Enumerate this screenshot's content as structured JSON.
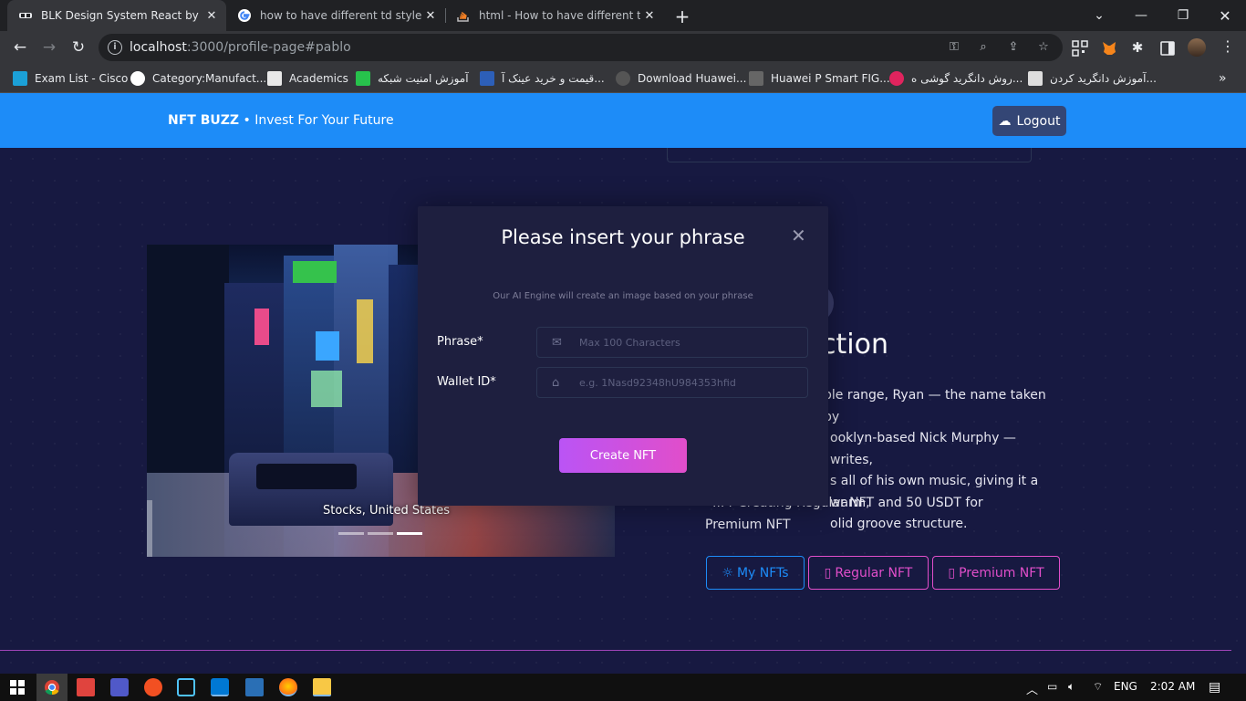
{
  "browser": {
    "tabs": [
      {
        "title": "BLK Design System React by Creative Tim",
        "active": true
      },
      {
        "title": "how to have different td styles in ...",
        "active": false
      },
      {
        "title": "html - How to have different table ...",
        "active": false
      }
    ],
    "new_tab_icon": "plus-icon",
    "url_host": "localhost",
    "url_path": ":3000/profile-page#pablo"
  },
  "bookmarks": [
    {
      "label": "Exam List - Cisco",
      "color": "#1ba0d7"
    },
    {
      "label": "Category:Manufact...",
      "color": "#ffffff"
    },
    {
      "label": "Academics",
      "color": "#e8e8e8"
    },
    {
      "label": "آموزش امنیت شبکه",
      "color": "#27c24c"
    },
    {
      "label": "قیمت و خرید عینک آ...",
      "color": "#2d5fb8"
    },
    {
      "label": "Download Huawei...",
      "color": "#555555"
    },
    {
      "label": "Huawei P Smart FIG...",
      "color": "#666666"
    },
    {
      "label": "روش دانگرید گوشی ه...",
      "color": "#e0245e"
    },
    {
      "label": "آموزش دانگرید کردن...",
      "color": "#dddddd"
    }
  ],
  "navbar": {
    "brand_bold": "NFT BUZZ",
    "brand_rest": " • Invest For Your Future",
    "logout_label": "Logout",
    "color": "#1d8cf8"
  },
  "carousel": {
    "caption": "Stocks, United States",
    "indicators": 3,
    "active_indicator": 2
  },
  "section": {
    "title_visible": "ction",
    "paragraph": "ple range, Ryan — the name taken by ooklyn-based Nick Murphy — writes, s all of his own music, giving it a warm, olid groove structure.",
    "lines": [
      "ple range, Ryan — the name taken by",
      "ooklyn-based Nick Murphy — writes,",
      "s all of his own music, giving it a warm,",
      "olid groove structure."
    ],
    "pricing_line1": "... r Creating Regular NFT and 50 USDT for",
    "pricing_line2": "Premium NFT"
  },
  "buttons": {
    "my_nfts": "My NFTs",
    "regular_nft": "Regular NFT",
    "premium_nft": "Premium NFT"
  },
  "modal": {
    "title": "Please insert your phrase",
    "subtitle": "Our AI Engine will create an image based on your phrase",
    "phrase_label": "Phrase*",
    "phrase_placeholder": "Max 100 Characters",
    "wallet_label": "Wallet ID*",
    "wallet_placeholder": "e.g. 1Nasd92348hU984353hfid",
    "submit_label": "Create NFT"
  },
  "taskbar": {
    "language": "ENG",
    "time": "2:02 AM"
  }
}
